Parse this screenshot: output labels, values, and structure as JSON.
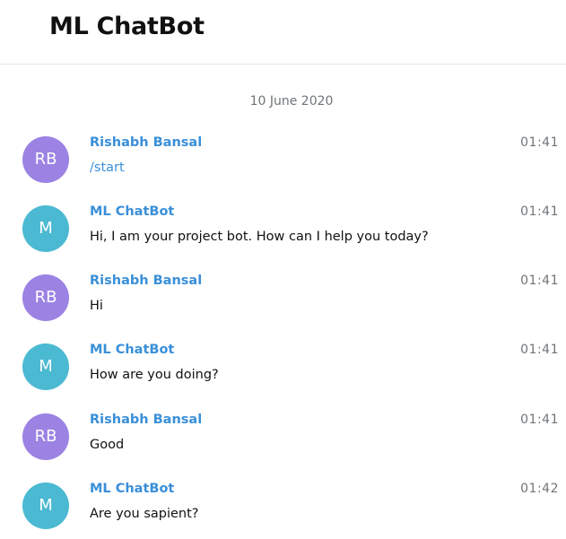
{
  "header": {
    "title": "ML ChatBot"
  },
  "date_separator": "10 June 2020",
  "colors": {
    "user_avatar": "#9b82e3",
    "bot_avatar": "#4bb9d2",
    "name": "#3a8fd9"
  },
  "messages": [
    {
      "initials": "RB",
      "sender": "Rishabh Bansal",
      "time": "01:41",
      "text": "/start"
    },
    {
      "initials": "M",
      "sender": "ML ChatBot",
      "time": "01:41",
      "text": "Hi, I am your project bot. How can I help you today?"
    },
    {
      "initials": "RB",
      "sender": "Rishabh Bansal",
      "time": "01:41",
      "text": "Hi"
    },
    {
      "initials": "M",
      "sender": "ML ChatBot",
      "time": "01:41",
      "text": "How are you doing?"
    },
    {
      "initials": "RB",
      "sender": "Rishabh Bansal",
      "time": "01:41",
      "text": "Good"
    },
    {
      "initials": "M",
      "sender": "ML ChatBot",
      "time": "01:42",
      "text": "Are you sapient?"
    }
  ]
}
